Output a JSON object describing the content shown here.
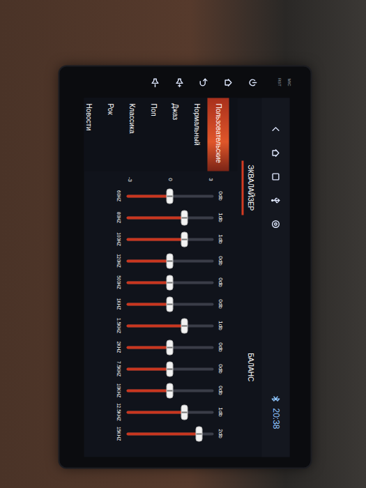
{
  "bezel": {
    "labels": [
      "MIC",
      "RST"
    ]
  },
  "status_bar": {
    "time": "20:38"
  },
  "tabs": [
    {
      "label": "ЭКВАЛАЙЗЕР",
      "selected": true
    },
    {
      "label": "БАЛАНС",
      "selected": false
    }
  ],
  "presets": [
    {
      "label": "Пользовательские",
      "selected": true
    },
    {
      "label": "Нормальный",
      "selected": false
    },
    {
      "label": "Джаз",
      "selected": false
    },
    {
      "label": "Поп",
      "selected": false
    },
    {
      "label": "Классика",
      "selected": false
    },
    {
      "label": "Рок",
      "selected": false
    },
    {
      "label": "Новости",
      "selected": false
    }
  ],
  "scale": [
    "3",
    "0",
    "-3"
  ],
  "bands": [
    {
      "freq": "60HZ",
      "reading": "0db",
      "level": 0.5
    },
    {
      "freq": "80HZ",
      "reading": "1db",
      "level": 0.667
    },
    {
      "freq": "100HZ",
      "reading": "1db",
      "level": 0.667
    },
    {
      "freq": "120HZ",
      "reading": "0db",
      "level": 0.5
    },
    {
      "freq": "500HZ",
      "reading": "0db",
      "level": 0.5
    },
    {
      "freq": "1KHZ",
      "reading": "0db",
      "level": 0.5
    },
    {
      "freq": "1.5KHZ",
      "reading": "1db",
      "level": 0.667
    },
    {
      "freq": "2KHZ",
      "reading": "0db",
      "level": 0.5
    },
    {
      "freq": "7.5KHZ",
      "reading": "0db",
      "level": 0.5
    },
    {
      "freq": "10KHZ",
      "reading": "0db",
      "level": 0.5
    },
    {
      "freq": "12.5KHZ",
      "reading": "1db",
      "level": 0.667
    },
    {
      "freq": "15KHZ",
      "reading": "2db",
      "level": 0.833
    }
  ]
}
